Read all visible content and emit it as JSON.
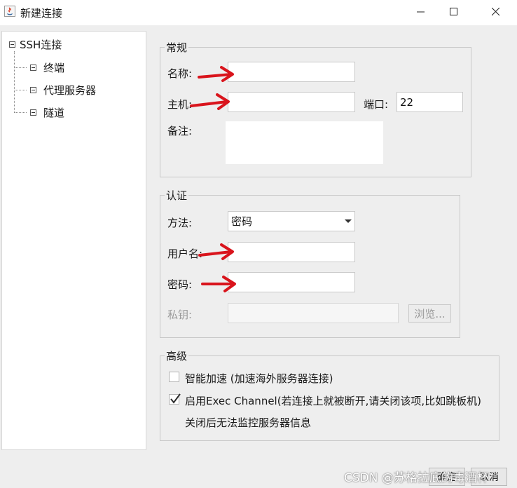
{
  "window": {
    "title": "新建连接",
    "controls": [
      "minimize-icon",
      "maximize-icon",
      "close-icon"
    ]
  },
  "tree": {
    "root": "SSH连接",
    "items": [
      "终端",
      "代理服务器",
      "隧道"
    ]
  },
  "general": {
    "title": "常规",
    "name_label": "名称:",
    "name_value": "",
    "host_label": "主机:",
    "host_value": "",
    "port_label": "端口:",
    "port_value": "22",
    "note_label": "备注:",
    "note_value": ""
  },
  "auth": {
    "title": "认证",
    "method_label": "方法:",
    "method_value": "密码",
    "user_label": "用户名:",
    "user_value": "",
    "password_label": "密码:",
    "password_value": "",
    "key_label": "私钥:",
    "key_value": "",
    "browse_label": "浏览..."
  },
  "advanced": {
    "title": "高级",
    "accel_label": "智能加速 (加速海外服务器连接)",
    "accel_checked": false,
    "exec_label": "启用Exec Channel(若连接上就被断开,请关闭该项,比如跳板机)",
    "exec_checked": true,
    "exec_note": "关闭后无法监控服务器信息"
  },
  "footer": {
    "ok_label": "确定",
    "cancel_label": "取消",
    "watermark": "CSDN @苏格拉底的毒酒杯"
  },
  "annotation_color": "#d9141c"
}
